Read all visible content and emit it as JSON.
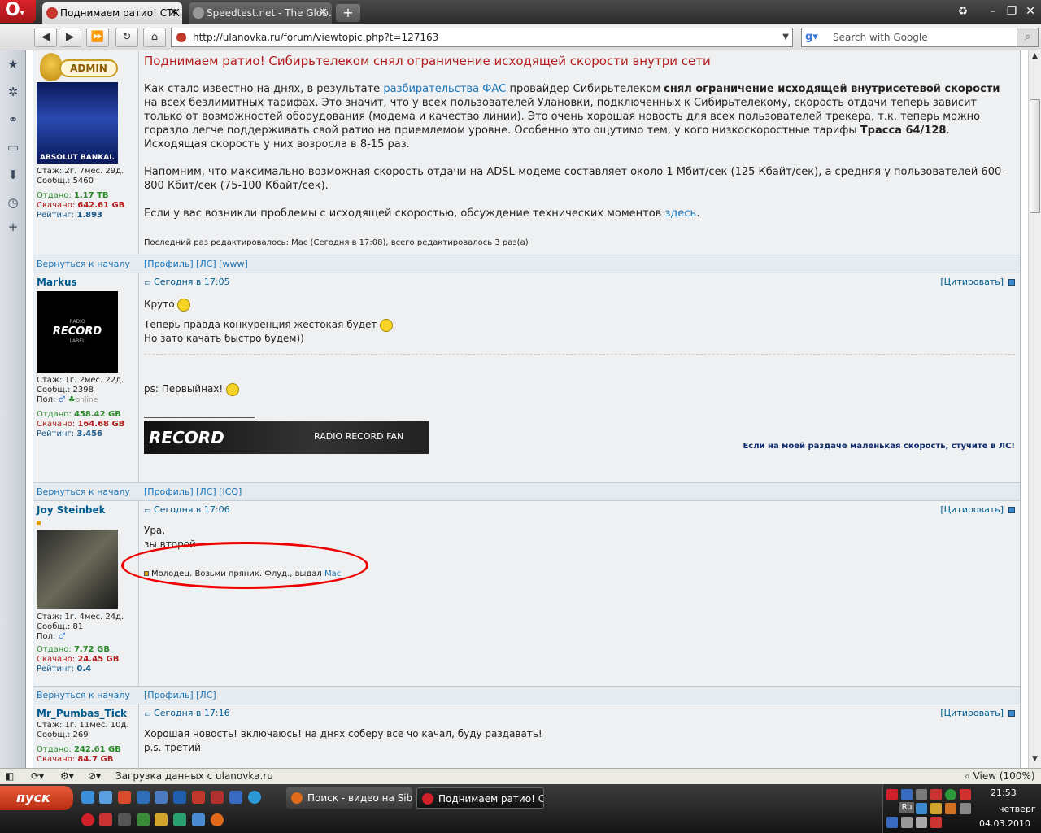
{
  "browser": {
    "tabs": [
      {
        "label": "Поднимаем ратио! СТК ...",
        "active": true
      },
      {
        "label": "Speedtest.net - The Glob...",
        "active": false
      }
    ],
    "url": "http://ulanovka.ru/forum/viewtopic.php?t=127163",
    "search_placeholder": "Search with Google",
    "status_text": "Загрузка данных с ulanovka.ru",
    "zoom": "View (100%)"
  },
  "post1": {
    "title": "Поднимаем ратио! Сибирьтелеком снял ограничение исходящей скорости внутри сети",
    "p1_a": "Как стало известно на днях, в результате ",
    "p1_link": "разбирательства ФАС",
    "p1_b": " провайдер Сибирьтелеком ",
    "p1_bold": "снял ограничение исходящей внутрисетевой скорости",
    "p1_c": " на всех безлимитных тарифах. Это значит, что у всех пользователей Улановки, подключенных к Сибирьтелекому, скорость отдачи теперь зависит только от возможностей оборудования (модема и качество линии). Это очень хорошая новость для всех пользователей трекера, т.к. теперь можно гораздо легче поддерживать свой ратио на приемлемом уровне. Особенно это ощутимо тем, у кого низкоскоростные тарифы ",
    "p1_bold2": "Трасса 64/128",
    "p1_d": ". Исходящая скорость у них возросла в 8-15 раз.",
    "p2": "Напомним, что максимально возможная скорость отдачи на ADSL-модеме составляет около 1 Мбит/сек (125 Кбайт/сек), а средняя у пользователей 600-800 Кбит/сек (75-100 Кбайт/сек).",
    "p3_a": "Если у вас возникли проблемы с исходящей скоростью, обсуждение технических моментов ",
    "p3_link": "здесь",
    "p3_b": ".",
    "edited": "Последний раз редактировалось: Mac (Сегодня в 17:08), всего редактировалось 3 раз(а)",
    "user": {
      "badge": "ADMIN",
      "avatar_caption": "ABSOLUT BANKAI.",
      "staz": "Стаж: 2г. 7мес. 29д.",
      "posts": "Сообщ.: 5460",
      "otdano_label": "Отдано: ",
      "otdano": "1.17 TB",
      "skachano_label": "Скачано: ",
      "skachano": "642.61 GB",
      "rating_label": "Рейтинг: ",
      "rating": "1.893"
    },
    "links": "[Профиль] [ЛС] [www]"
  },
  "back_to_top": "Вернуться к началу",
  "cite": "[Цитировать]",
  "post2": {
    "user": "Markus",
    "avatar_text": "RECORD",
    "avatar_small": "RADIO",
    "avatar_small2": "LABEL",
    "staz": "Стаж: 1г. 2мес. 22д.",
    "posts": "Сообщ.: 2398",
    "pol": "Пол:",
    "online": "online",
    "otdano": "458.42 GB",
    "skachano": "164.68 GB",
    "rating": "3.456",
    "time": "Сегодня в 17:05",
    "l1": "Круто",
    "l2": "Теперь правда конкуренция жестокая будет",
    "l3": "Но зато качать быстро будем))",
    "l4": "ps: Первыйнах!",
    "banner_text": "RADIO RECORD FAN",
    "sig": "Если на моей раздаче маленькая скорость, стучите в ЛС!",
    "links": "[Профиль] [ЛС] [ICQ]"
  },
  "post3": {
    "user": "Joy Steinbek",
    "staz": "Стаж: 1г. 4мес. 24д.",
    "posts": "Сообщ.: 81",
    "pol": "Пол:",
    "otdano": "7.72 GB",
    "skachano": "24.45 GB",
    "rating": "0.4",
    "time": "Сегодня в 17:06",
    "l1": "Ура,",
    "l2": "зы второй",
    "award": "Молодец. Возьми пряник. Флуд., выдал ",
    "award_by": "Mac",
    "links": "[Профиль] [ЛС]"
  },
  "post4": {
    "user": "Mr_Pumbas_Tick",
    "staz": "Стаж: 1г. 11мес. 10д.",
    "posts": "Сообщ.: 269",
    "otdano": "242.61 GB",
    "skachano": "84.7 GB",
    "time": "Сегодня в 17:16",
    "l1": "Хорошая новость! включаюсь! на днях соберу все чо качал, буду раздавать!",
    "l2": "p.s. третий"
  },
  "taskbar": {
    "start": "пуск",
    "tasks": [
      "Поиск - видео на Sib...",
      "Поднимаем ратио! С..."
    ],
    "time": "21:53",
    "day": "четверг",
    "date": "04.03.2010",
    "lang": "Ru"
  }
}
